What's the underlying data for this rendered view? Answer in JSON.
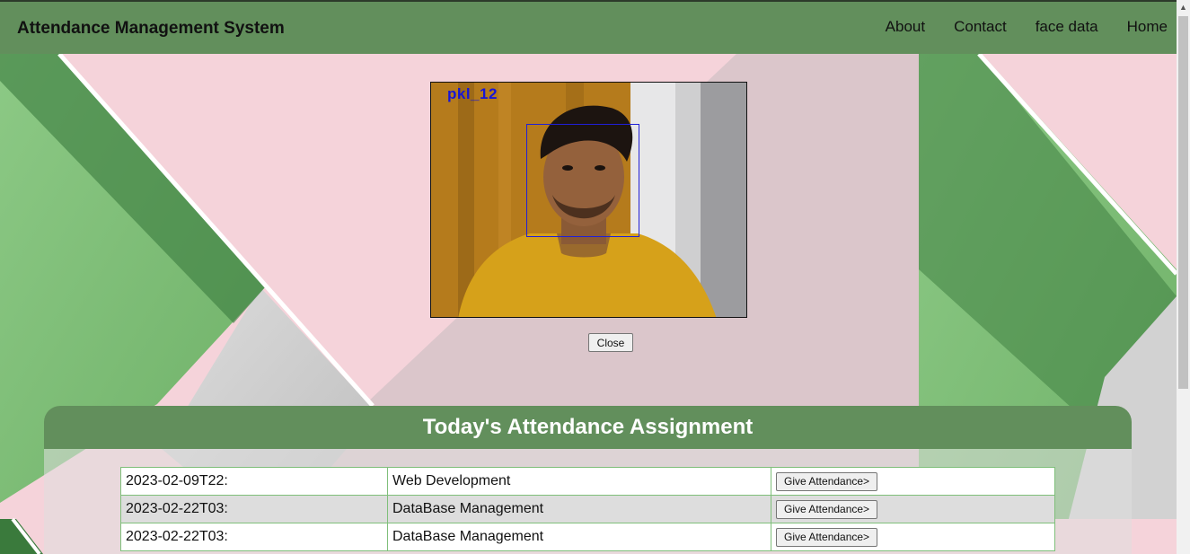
{
  "app": {
    "title": "Attendance Management System"
  },
  "nav": {
    "links": [
      "About",
      "Contact",
      "face data",
      "Home"
    ]
  },
  "camera": {
    "label": "pkl_12",
    "close_label": "Close"
  },
  "attendance": {
    "title": "Today's Attendance Assignment",
    "rows": [
      {
        "date": "2023-02-09T22:",
        "subject": "Web Development",
        "action": "Give Attendance>"
      },
      {
        "date": "2023-02-22T03:",
        "subject": "DataBase Management",
        "action": "Give Attendance>"
      },
      {
        "date": "2023-02-22T03:",
        "subject": "DataBase Management",
        "action": "Give Attendance>"
      }
    ]
  },
  "colors": {
    "nav": "#628f5c",
    "accent_green": "#84c27c",
    "dark_green": "#3a7a3c",
    "pink": "#f5d3da",
    "box": "#1f1fd8"
  }
}
